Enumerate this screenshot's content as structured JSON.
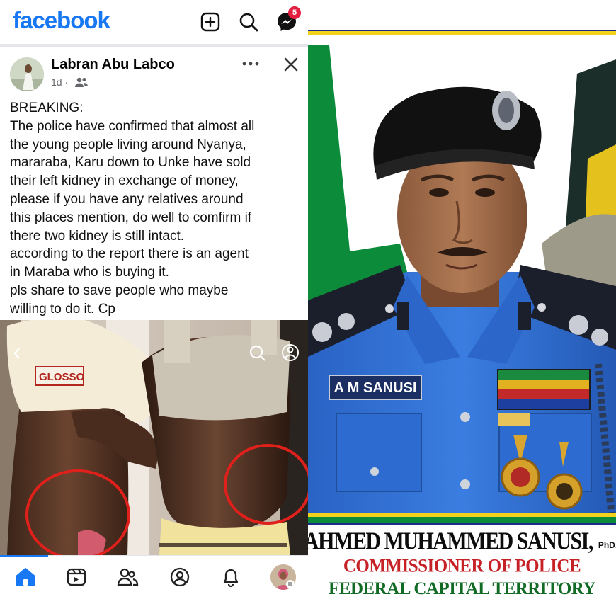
{
  "facebook": {
    "logo": "facebook",
    "header_icons": [
      "add-icon",
      "search-icon",
      "messenger-icon"
    ],
    "messenger_badge": "5",
    "post": {
      "author": "Labran Abu Labco",
      "time": "1d ·",
      "audience_icon": "friends-icon",
      "lines": [
        "BREAKING:",
        "The police have confirmed that almost all",
        "the young people living around Nyanya,",
        "mararaba, Karu down to Unke have sold",
        "their left kidney in exchange of money,",
        "please if you have any relatives around",
        "this places mention, do well to comfirm if",
        "there two kidney is still intact.",
        "according to the report there is an agent",
        "in Maraba who is buying it.",
        "pls share to save people who maybe",
        "willing to do it. Cp"
      ],
      "photo_shirt_text": "GLOSSO"
    },
    "nav_icons": [
      "home-icon",
      "video-icon",
      "friends-icon",
      "profile-icon",
      "bell-icon",
      "avatar"
    ],
    "colors": {
      "brand": "#1877f2",
      "badge": "#e41e3f",
      "circle": "#e0201b"
    }
  },
  "poster": {
    "nametag": "A M SANUSI",
    "name": "AHMED MUHAMMED SANUSI,",
    "qualifications": "PhD, Fcai Fipma, Feu, AMBP-UN F",
    "rank": "COMMISSIONER OF POLICE",
    "command": "FEDERAL CAPITAL TERRITORY",
    "colors": {
      "rank_text": "#c62126",
      "command_text": "#116b25",
      "uniform": "#2f6fd2",
      "stripe_yellow": "#f3d21c",
      "stripe_blue": "#1c2a8c"
    }
  }
}
